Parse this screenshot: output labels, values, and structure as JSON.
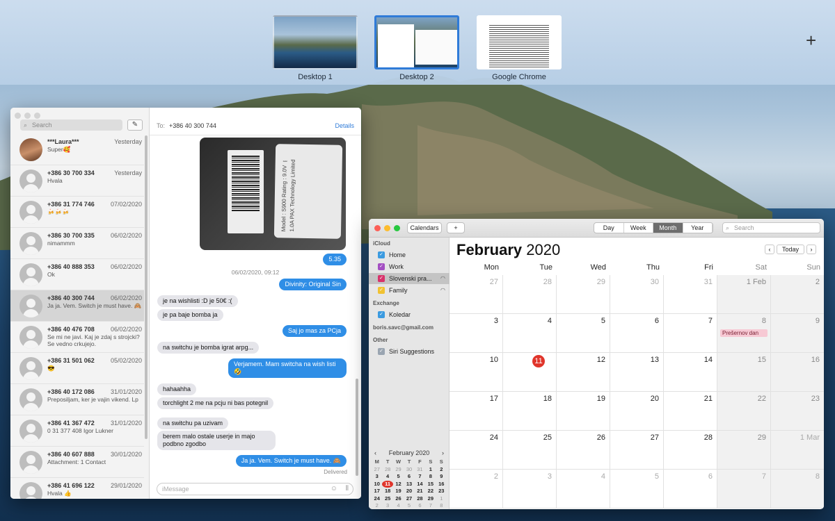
{
  "spaces": [
    {
      "label": "Desktop 1"
    },
    {
      "label": "Desktop 2"
    },
    {
      "label": "Google Chrome"
    }
  ],
  "add_space_label": "+",
  "messages": {
    "search_placeholder": "Search",
    "to_label": "To:",
    "to_value": "+386 40 300 744",
    "details_label": "Details",
    "conversations": [
      {
        "name": "***Laura***",
        "date": "Yesterday",
        "preview": "Super🥰"
      },
      {
        "name": "+386 30 700 334",
        "date": "Yesterday",
        "preview": "Hvala"
      },
      {
        "name": "+386 31 774 746",
        "date": "07/02/2020",
        "preview": "🍻🍻🍻"
      },
      {
        "name": "+386 30 700 335",
        "date": "06/02/2020",
        "preview": "nimammm"
      },
      {
        "name": "+386 40 888 353",
        "date": "06/02/2020",
        "preview": "Ok"
      },
      {
        "name": "+386 40 300 744",
        "date": "06/02/2020",
        "preview": "Ja ja. Vem. Switch je must have. 🙈"
      },
      {
        "name": "+386 40 476 708",
        "date": "06/02/2020",
        "preview": "Se mi ne javi. Kaj je zdaj s strojcki? Se vedno crkujejo."
      },
      {
        "name": "+386 31 501 062",
        "date": "05/02/2020",
        "preview": "😎"
      },
      {
        "name": "+386 40 172 086",
        "date": "31/01/2020",
        "preview": "Preposiljam, ker je vajin vikend. Lp"
      },
      {
        "name": "+386 41 367 472",
        "date": "31/01/2020",
        "preview": "0 31 377 408 Igor Lukner"
      },
      {
        "name": "+386 40 607 888",
        "date": "30/01/2020",
        "preview": "Attachment: 1 Contact"
      },
      {
        "name": "+386 41 696 122",
        "date": "29/01/2020",
        "preview": "Hvala 👍"
      }
    ],
    "bubble_time": "5.35",
    "timestamp": "06/02/2020, 09:12",
    "bubbles": [
      {
        "dir": "out",
        "text": "Divinity: Original Sin"
      },
      {
        "dir": "in",
        "text": "je na wishlisti :D je 50€ :("
      },
      {
        "dir": "in",
        "text": "je pa baje bomba ja"
      },
      {
        "dir": "out",
        "text": "Saj jo mas za PCja"
      },
      {
        "dir": "in",
        "text": "na switchu je bomba igrat arpg..."
      },
      {
        "dir": "out",
        "text": "Verjamem. Mam switcha na wish listi 🤣"
      },
      {
        "dir": "in",
        "text": "hahaahha"
      },
      {
        "dir": "in",
        "text": "torchlight 2 me na pcju ni bas potegnil"
      },
      {
        "dir": "in",
        "text": "na switchu pa uzivam"
      },
      {
        "dir": "in",
        "text": "berem malo ostale userje in majo podbno zgodbo"
      },
      {
        "dir": "out",
        "text": "Ja ja. Vem. Switch je must have. 🙈"
      }
    ],
    "delivered_label": "Delivered",
    "photo_text": "Model : S900 Rating : 9.0V ⎓ 1.0A PAX Technology Limited",
    "input_placeholder": "iMessage"
  },
  "calendar": {
    "calendars_button": "Calendars",
    "add_button": "+",
    "views": [
      "Day",
      "Week",
      "Month",
      "Year"
    ],
    "active_view": "Month",
    "search_placeholder": "Search",
    "groups": [
      {
        "title": "iCloud",
        "items": [
          {
            "name": "Home",
            "color": "#3c9be0"
          },
          {
            "name": "Work",
            "color": "#a34fc2"
          },
          {
            "name": "Slovenski pra...",
            "color": "#d8336b"
          },
          {
            "name": "Family",
            "color": "#f1c232"
          }
        ]
      },
      {
        "title": "Exchange",
        "items": [
          {
            "name": "Koledar",
            "color": "#3c9be0"
          }
        ]
      },
      {
        "title": "boris.savc@gmail.com",
        "items": []
      },
      {
        "title": "Other",
        "items": [
          {
            "name": "Siri Suggestions",
            "color": "#9aa5b1"
          }
        ]
      }
    ],
    "month_name": "February",
    "year": "2020",
    "today_button": "Today",
    "prev": "‹",
    "next": "›",
    "weekdays": [
      "Mon",
      "Tue",
      "Wed",
      "Thu",
      "Fri",
      "Sat",
      "Sun"
    ],
    "weeks": [
      [
        "27",
        "28",
        "29",
        "30",
        "31",
        "1 Feb",
        "2"
      ],
      [
        "3",
        "4",
        "5",
        "6",
        "7",
        "8",
        "9"
      ],
      [
        "10",
        "11",
        "12",
        "13",
        "14",
        "15",
        "16"
      ],
      [
        "17",
        "18",
        "19",
        "20",
        "21",
        "22",
        "23"
      ],
      [
        "24",
        "25",
        "26",
        "27",
        "28",
        "29",
        "1 Mar"
      ],
      [
        "2",
        "3",
        "4",
        "5",
        "6",
        "7",
        "8"
      ]
    ],
    "today": "11",
    "event": {
      "title": "Prešernov dan",
      "date": "8"
    },
    "mini": {
      "title": "February 2020",
      "headers": [
        "M",
        "T",
        "W",
        "T",
        "F",
        "S",
        "S"
      ],
      "weeks": [
        [
          "27",
          "28",
          "29",
          "30",
          "31",
          "1",
          "2"
        ],
        [
          "3",
          "4",
          "5",
          "6",
          "7",
          "8",
          "9"
        ],
        [
          "10",
          "11",
          "12",
          "13",
          "14",
          "15",
          "16"
        ],
        [
          "17",
          "18",
          "19",
          "20",
          "21",
          "22",
          "23"
        ],
        [
          "24",
          "25",
          "26",
          "27",
          "28",
          "29",
          "1"
        ],
        [
          "2",
          "3",
          "4",
          "5",
          "6",
          "7",
          "8"
        ]
      ]
    }
  }
}
